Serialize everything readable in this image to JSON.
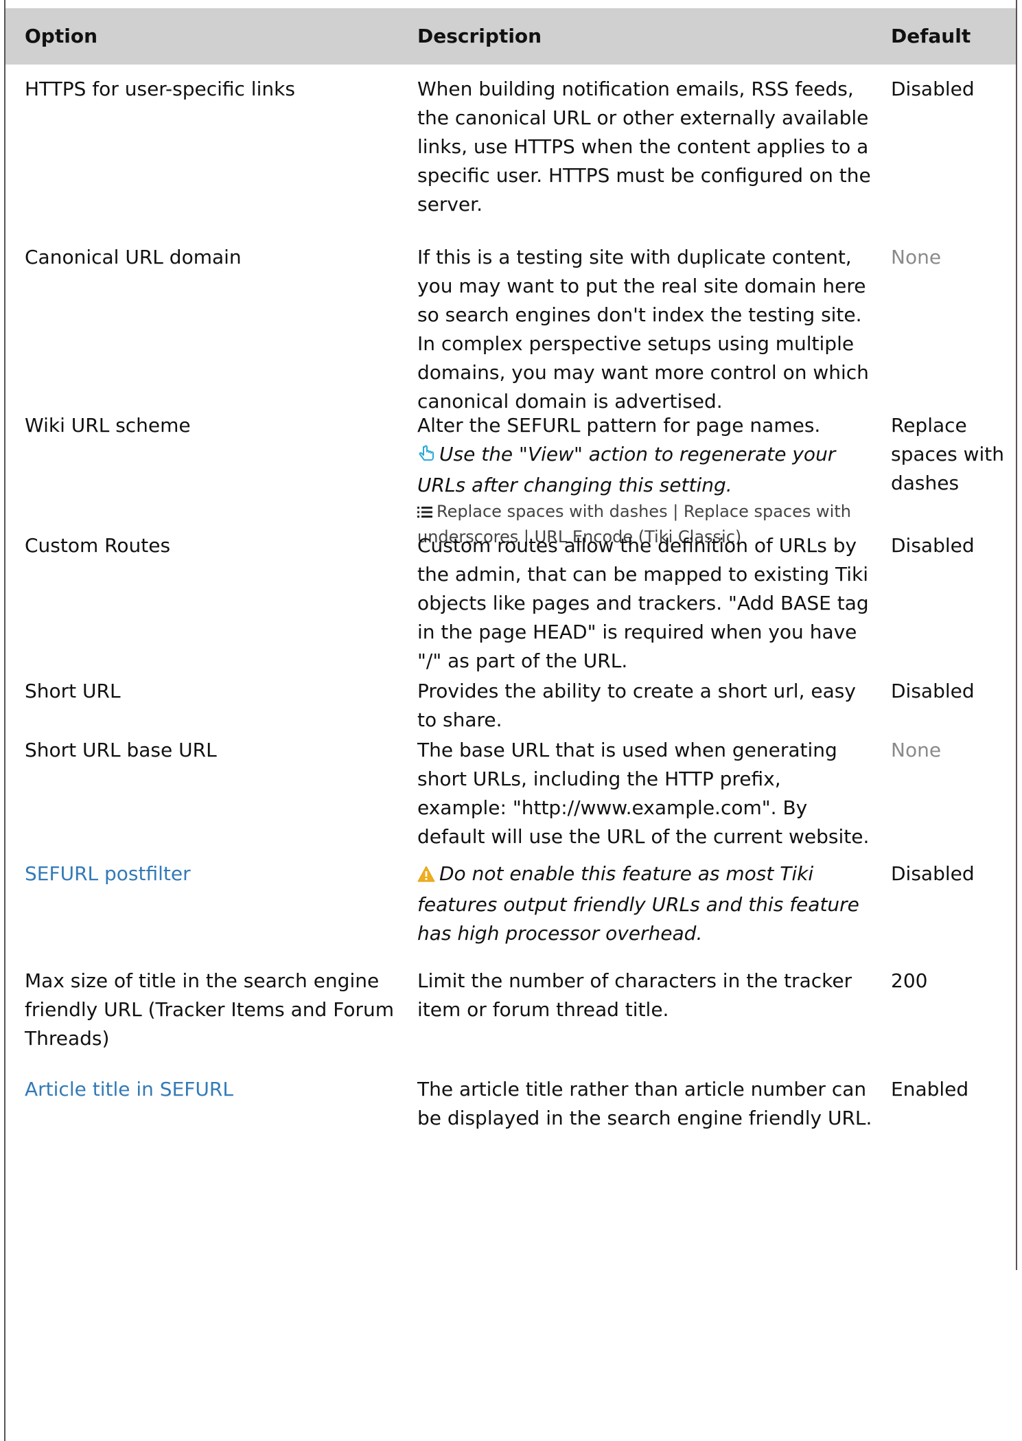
{
  "colors": {
    "header_bg": "#d0d0d0",
    "link": "#337ab7",
    "muted": "#8a8a8a",
    "hint_icon": "#29a8d8",
    "warning_icon": "#f0ad1e"
  },
  "columns": {
    "option": "Option",
    "description": "Description",
    "default": "Default"
  },
  "rows": [
    {
      "option": "HTTPS for user-specific links",
      "option_link": false,
      "description": "When building notification emails, RSS feeds, the canonical URL or other externally available links, use HTTPS when the content applies to a specific user. HTTPS must be configured on the server.",
      "default": "Disabled",
      "default_muted": false
    },
    {
      "option": "Canonical URL domain",
      "option_link": false,
      "description": "If this is a testing site with duplicate content, you may want to put the real site domain here so search engines don't index the testing site. In complex perspective setups using multiple domains, you may want more control on which canonical domain is advertised.",
      "default": "None",
      "default_muted": true
    },
    {
      "option": "Wiki URL scheme",
      "option_link": false,
      "description": "Alter the SEFURL pattern for page names.",
      "hint_icon": "pointing-hand-icon",
      "hint": "Use the \"View\" action to regenerate your URLs after changing this setting.",
      "options_icon": "list-icon",
      "options": "Replace spaces with dashes | Replace spaces with underscores | URL Encode (Tiki Classic)",
      "default": "Replace spaces with dashes",
      "default_muted": false
    },
    {
      "option": "Custom Routes",
      "option_link": false,
      "description": "Custom routes allow the definition of URLs by the admin, that can be mapped to existing Tiki objects like pages and trackers. \"Add BASE tag in the page HEAD\" is required when you have \"/\" as part of the URL.",
      "default": "Disabled",
      "default_muted": false
    },
    {
      "option": "Short URL",
      "option_link": false,
      "description": "Provides the ability to create a short url, easy to share.",
      "default": "Disabled",
      "default_muted": false
    },
    {
      "option": "Short URL base URL",
      "option_link": false,
      "description": "The base URL that is used when generating short URLs, including the HTTP prefix, example: \"http://www.example.com\". By default will use the URL of the current website.",
      "default": "None",
      "default_muted": true
    },
    {
      "option": "SEFURL postfilter",
      "option_link": true,
      "warning_icon": "warning-icon",
      "warning": "Do not enable this feature as most Tiki features output friendly URLs and this feature has high processor overhead.",
      "default": "Disabled",
      "default_muted": false
    },
    {
      "option": "Max size of title in the search engine friendly URL (Tracker Items and Forum Threads)",
      "option_link": false,
      "description": "Limit the number of characters in the tracker item or forum thread title.",
      "default": "200",
      "default_muted": false
    },
    {
      "option": "Article title in SEFURL",
      "option_link": true,
      "description": "The article title rather than article number can be displayed in the search engine friendly URL.",
      "default": "Enabled",
      "default_muted": false
    }
  ]
}
